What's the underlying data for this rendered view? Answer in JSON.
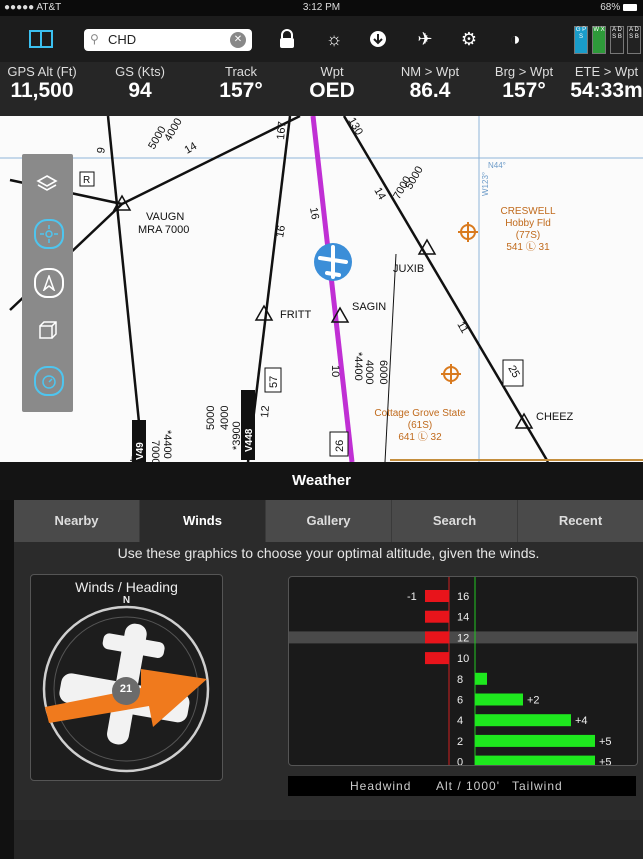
{
  "status": {
    "carrier": "●●●●● AT&T",
    "time": "3:12 PM",
    "battery": "68%"
  },
  "toolbar": {
    "search_value": "CHD",
    "badges": [
      {
        "label": "G P S",
        "color": "#1a9cc9"
      },
      {
        "label": "W X",
        "color": "#2e9a3a"
      },
      {
        "label": "A D S B",
        "color": "#222222"
      },
      {
        "label": "A D S B",
        "color": "#222222"
      }
    ]
  },
  "strip": [
    {
      "label": "GPS Alt (Ft)",
      "value": "11,500"
    },
    {
      "label": "GS (Kts)",
      "value": "94"
    },
    {
      "label": "Track",
      "value": "157°"
    },
    {
      "label": "Wpt",
      "value": "OED"
    },
    {
      "label": "NM > Wpt",
      "value": "86.4"
    },
    {
      "label": "Brg > Wpt",
      "value": "157°"
    },
    {
      "label": "ETE > Wpt",
      "value": "54:33m"
    }
  ],
  "map": {
    "labels": {
      "vaugn": "VAUGN",
      "vaugn_mra": "MRA 7000",
      "juxib": "JUXIB",
      "sagin": "SAGIN",
      "fritt": "FRITT",
      "cheez": "CHEEZ",
      "creswell1": "CRESWELL",
      "creswell2": "Hobby Fld",
      "creswell3": "(77S)",
      "creswell4": "541 Ⓛ 31",
      "cottage1": "Cottage Grove State",
      "cottage2": "(61S)",
      "cottage3": "641 Ⓛ 32",
      "v448": "V448",
      "v49": "V49",
      "r57": "57",
      "r26": "26",
      "r25": "25",
      "n44": "N44°",
      "w123": "W123°",
      "alt5000": "5000",
      "alt4000": "4000",
      "alt7000": "7000",
      "alt6000": "6000",
      "alt3900": "*3900",
      "alt4400": "*4400",
      "m167": "167",
      "m130": "130",
      "m14a": "14",
      "m16a": "16",
      "m16b": "16",
      "m14b": "14",
      "m11": "11",
      "m10": "10",
      "m12": "12",
      "m47": "47",
      "m9": "9",
      "mR": "R"
    }
  },
  "weather": {
    "title": "Weather",
    "tabs": [
      "Nearby",
      "Winds",
      "Gallery",
      "Search",
      "Recent"
    ],
    "active_tab": "Winds",
    "instructions": "Use these graphics to choose your optimal altitude, given the winds.",
    "winds_heading": {
      "title": "Winds / Heading",
      "north": "N",
      "wind_speed": "21"
    },
    "legend": {
      "headwind": "Headwind",
      "alt": "Alt / 1000'",
      "tailwind": "Tailwind"
    }
  },
  "chart_data": {
    "type": "bar",
    "orientation": "horizontal",
    "categories": [
      "16",
      "14",
      "12",
      "10",
      "8",
      "6",
      "4",
      "2",
      "0"
    ],
    "values": [
      -1,
      -1,
      -1,
      -1,
      0.5,
      2,
      4,
      5,
      5
    ],
    "value_labels": [
      "-1",
      "",
      "",
      "",
      "",
      "+2",
      "+4",
      "+5",
      "+5"
    ],
    "xlabel": "Headwind   Alt / 1000'   Tailwind",
    "highlight_category": "12",
    "colors": {
      "headwind": "#e8141b",
      "tailwind": "#1ee81e"
    }
  }
}
